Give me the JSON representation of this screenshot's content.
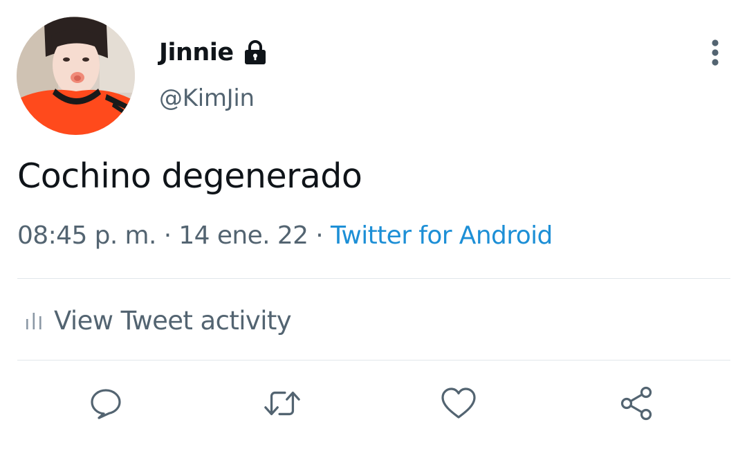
{
  "tweet": {
    "display_name": "Jinnie",
    "handle": "@KimJin",
    "protected_icon": "lock-icon",
    "text": "Cochino degenerado",
    "time": "08:45 p. m.",
    "separator": "·",
    "date": "14 ene. 22",
    "source": "Twitter for Android",
    "activity_label": "View Tweet activity"
  },
  "actions": [
    {
      "name": "reply",
      "icon": "speech-bubble-icon"
    },
    {
      "name": "retweet",
      "icon": "retweet-icon"
    },
    {
      "name": "like",
      "icon": "heart-icon"
    },
    {
      "name": "share",
      "icon": "share-icon"
    }
  ],
  "colors": {
    "text_primary": "#0f1419",
    "text_secondary": "#536471",
    "link": "#1d8fd6",
    "divider": "#e1e6ea",
    "avatar_shirt": "#ff4a1c"
  }
}
